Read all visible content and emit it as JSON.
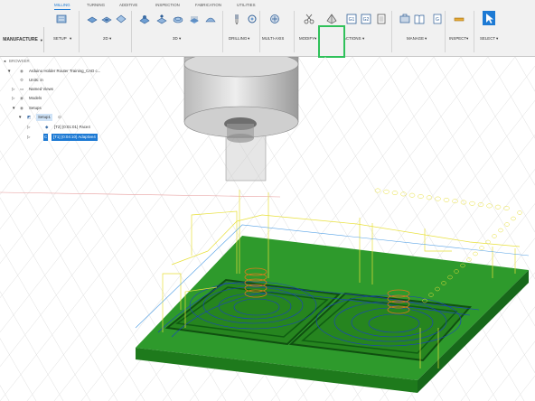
{
  "toolbar": {
    "workspace": "MANUFACTURE",
    "tabs": [
      "MILLING",
      "TURNING",
      "ADDITIVE",
      "INSPECTION",
      "FABRICATION",
      "UTILITIES"
    ],
    "active_tab": "MILLING",
    "groups": [
      "SETUP",
      "2D",
      "3D",
      "DRILLING",
      "MULTI-AXIS",
      "MODIFY",
      "ACTIONS",
      "MANAGE",
      "INSPECT",
      "SELECT"
    ]
  },
  "browser": {
    "title": "BROWSER",
    "document": "Arduino Holder Router Training_CAD c...",
    "units": "Units: in",
    "named_views": "Named Views",
    "models": "Models",
    "setups": "Setups",
    "setup": "Setup1",
    "ops": [
      "[T2] (0:01:01) Face4",
      "[T1] (0:04:10) Adaptive4"
    ]
  },
  "colors": {
    "accent": "#1d7ad4",
    "highlight": "#2fc15a",
    "part": "#2f9a2d",
    "toolpath_blue": "#1a3ec9",
    "toolpath_yellow": "#f2ea3a"
  }
}
